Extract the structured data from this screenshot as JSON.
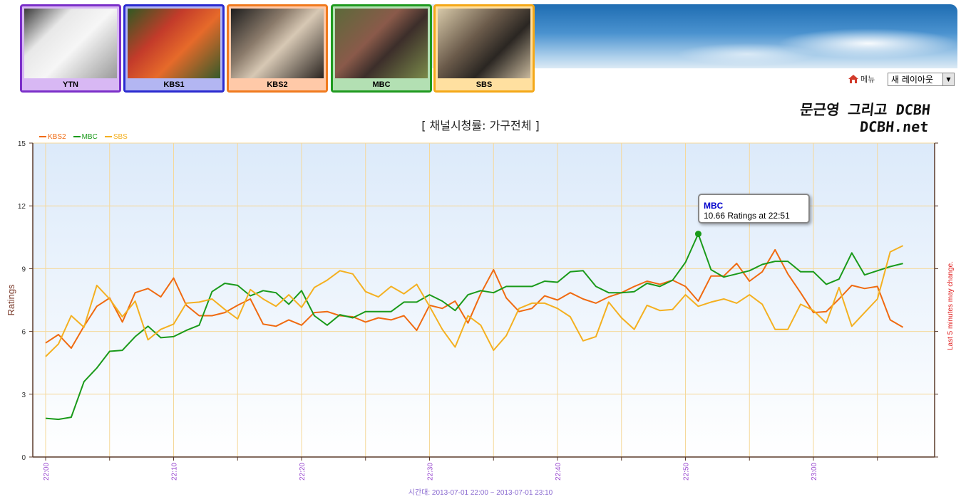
{
  "channels": [
    {
      "name": "YTN",
      "border": "#7b2fc9",
      "label_bg": "#d8b8f4"
    },
    {
      "name": "KBS1",
      "border": "#2a2ad0",
      "label_bg": "#b3b6f2"
    },
    {
      "name": "KBS2",
      "border": "#f07a1e",
      "label_bg": "#ffc9a8"
    },
    {
      "name": "MBC",
      "border": "#1f9a1f",
      "label_bg": "#b3e0b3"
    },
    {
      "name": "SBS",
      "border": "#f4a818",
      "label_bg": "#ffe0a0"
    }
  ],
  "menu": {
    "label": "메뉴",
    "layout_select": "새 레이아웃"
  },
  "brand": {
    "line1": "문근영 그리고 DCBH",
    "line2": "DCBH.net"
  },
  "chart_data": {
    "type": "line",
    "title": "[ 채널시청률: 가구전체 ]",
    "ylabel": "Ratings",
    "right_note": "Last 5 minutes may change.",
    "footer": "시간대: 2013-07-01 22:00 ~ 2013-07-01 23:10",
    "ylim": [
      0,
      15
    ],
    "yticks": [
      0,
      3,
      6,
      9,
      12,
      15
    ],
    "x_minutes_range": [
      0,
      70
    ],
    "xticks": [
      {
        "minute": 0,
        "label": "22:00"
      },
      {
        "minute": 10,
        "label": "22:10"
      },
      {
        "minute": 20,
        "label": "22:20"
      },
      {
        "minute": 30,
        "label": "22:30"
      },
      {
        "minute": 40,
        "label": "22:40"
      },
      {
        "minute": 50,
        "label": "22:50"
      },
      {
        "minute": 60,
        "label": "23:00"
      }
    ],
    "grid": true,
    "legend_position": "top-left",
    "x_start_minute": 0,
    "x_step_minutes": 1,
    "series": [
      {
        "name": "KBS2",
        "color": "#f06a10",
        "values": [
          5.45,
          5.85,
          5.2,
          6.25,
          7.2,
          7.6,
          6.45,
          7.85,
          8.05,
          7.65,
          8.55,
          7.25,
          6.75,
          6.75,
          6.9,
          7.25,
          7.55,
          6.35,
          6.25,
          6.55,
          6.3,
          6.9,
          6.95,
          6.75,
          6.7,
          6.45,
          6.65,
          6.55,
          6.75,
          6.05,
          7.25,
          7.1,
          7.45,
          6.4,
          7.8,
          8.95,
          7.6,
          6.95,
          7.1,
          7.7,
          7.5,
          7.85,
          7.55,
          7.35,
          7.65,
          7.85,
          8.15,
          8.4,
          8.25,
          8.45,
          8.15,
          7.45,
          8.65,
          8.65,
          9.25,
          8.4,
          8.85,
          9.9,
          8.75,
          7.85,
          6.9,
          6.95,
          7.55,
          8.2,
          8.05,
          8.15,
          6.55,
          6.2
        ]
      },
      {
        "name": "MBC",
        "color": "#1a9a1a",
        "values": [
          1.85,
          1.8,
          1.9,
          3.6,
          4.25,
          5.05,
          5.1,
          5.75,
          6.25,
          5.7,
          5.75,
          6.05,
          6.3,
          7.9,
          8.3,
          8.2,
          7.7,
          7.95,
          7.85,
          7.3,
          7.95,
          6.75,
          6.3,
          6.8,
          6.65,
          6.95,
          6.95,
          6.95,
          7.4,
          7.4,
          7.75,
          7.45,
          7.0,
          7.75,
          7.95,
          7.85,
          8.15,
          8.15,
          8.15,
          8.4,
          8.35,
          8.85,
          8.9,
          8.15,
          7.85,
          7.85,
          7.9,
          8.3,
          8.15,
          8.45,
          9.3,
          10.66,
          8.95,
          8.6,
          8.75,
          8.9,
          9.2,
          9.35,
          9.35,
          8.85,
          8.85,
          8.25,
          8.5,
          9.75,
          8.7,
          8.9,
          9.1,
          9.25
        ]
      },
      {
        "name": "SBS",
        "color": "#f4b020",
        "values": [
          4.8,
          5.4,
          6.75,
          6.2,
          8.2,
          7.55,
          6.7,
          7.45,
          5.6,
          6.1,
          6.35,
          7.35,
          7.4,
          7.55,
          7.05,
          6.6,
          8.0,
          7.55,
          7.2,
          7.75,
          7.15,
          8.1,
          8.45,
          8.9,
          8.75,
          7.9,
          7.65,
          8.15,
          7.8,
          8.25,
          7.2,
          6.1,
          5.25,
          6.75,
          6.3,
          5.1,
          5.8,
          7.1,
          7.35,
          7.35,
          7.1,
          6.7,
          5.55,
          5.75,
          7.4,
          6.65,
          6.1,
          7.25,
          7.0,
          7.05,
          7.75,
          7.2,
          7.4,
          7.55,
          7.35,
          7.75,
          7.3,
          6.1,
          6.1,
          7.3,
          7.0,
          6.4,
          8.1,
          6.25,
          6.9,
          7.55,
          9.8,
          10.1
        ]
      }
    ],
    "tooltip": {
      "series": "MBC",
      "text": "10.66 Ratings at 22:51"
    }
  }
}
